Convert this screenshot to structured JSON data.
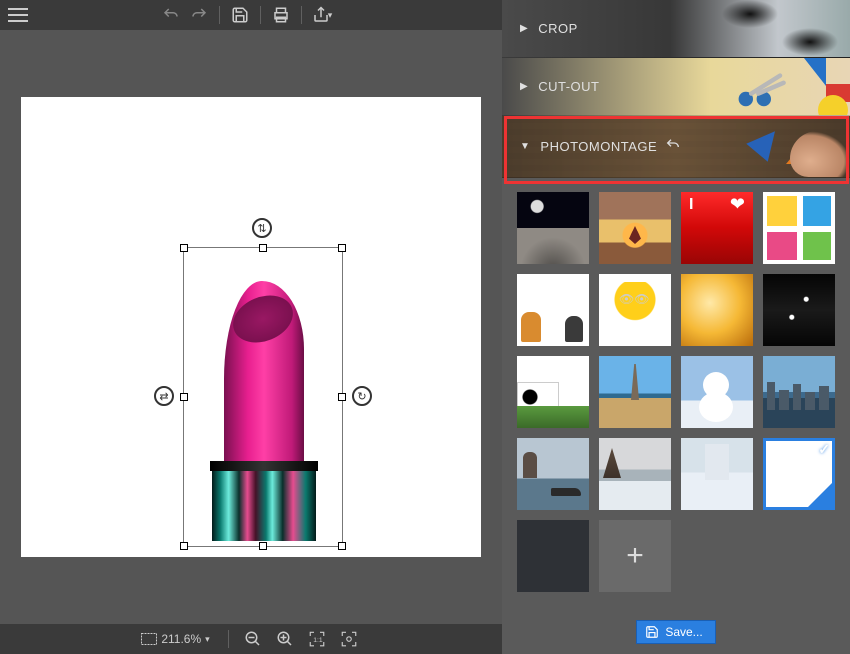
{
  "toolbar": {
    "undo": "undo",
    "redo": "redo",
    "save": "save",
    "print": "print",
    "share": "share"
  },
  "panels": {
    "crop": {
      "label": "CROP",
      "expanded": false
    },
    "cutout": {
      "label": "CUT-OUT",
      "expanded": false
    },
    "photomontage": {
      "label": "PHOTOMONTAGE",
      "expanded": true
    }
  },
  "thumbnails": [
    {
      "name": "moon-surface"
    },
    {
      "name": "sunset-field"
    },
    {
      "name": "red-heart"
    },
    {
      "name": "comic-bubbles"
    },
    {
      "name": "animals-white"
    },
    {
      "name": "yellow-monster"
    },
    {
      "name": "golden-bokeh"
    },
    {
      "name": "dark-sparkle"
    },
    {
      "name": "cow-grass"
    },
    {
      "name": "eiffel-tower"
    },
    {
      "name": "snowman"
    },
    {
      "name": "city-skyline"
    },
    {
      "name": "venice"
    },
    {
      "name": "winter-trees"
    },
    {
      "name": "winter-snow"
    },
    {
      "name": "blank-white",
      "selected": true
    },
    {
      "name": "dark-blank"
    }
  ],
  "save_button": "Save...",
  "zoom": {
    "value": "211.6%",
    "chevron": "▾"
  }
}
